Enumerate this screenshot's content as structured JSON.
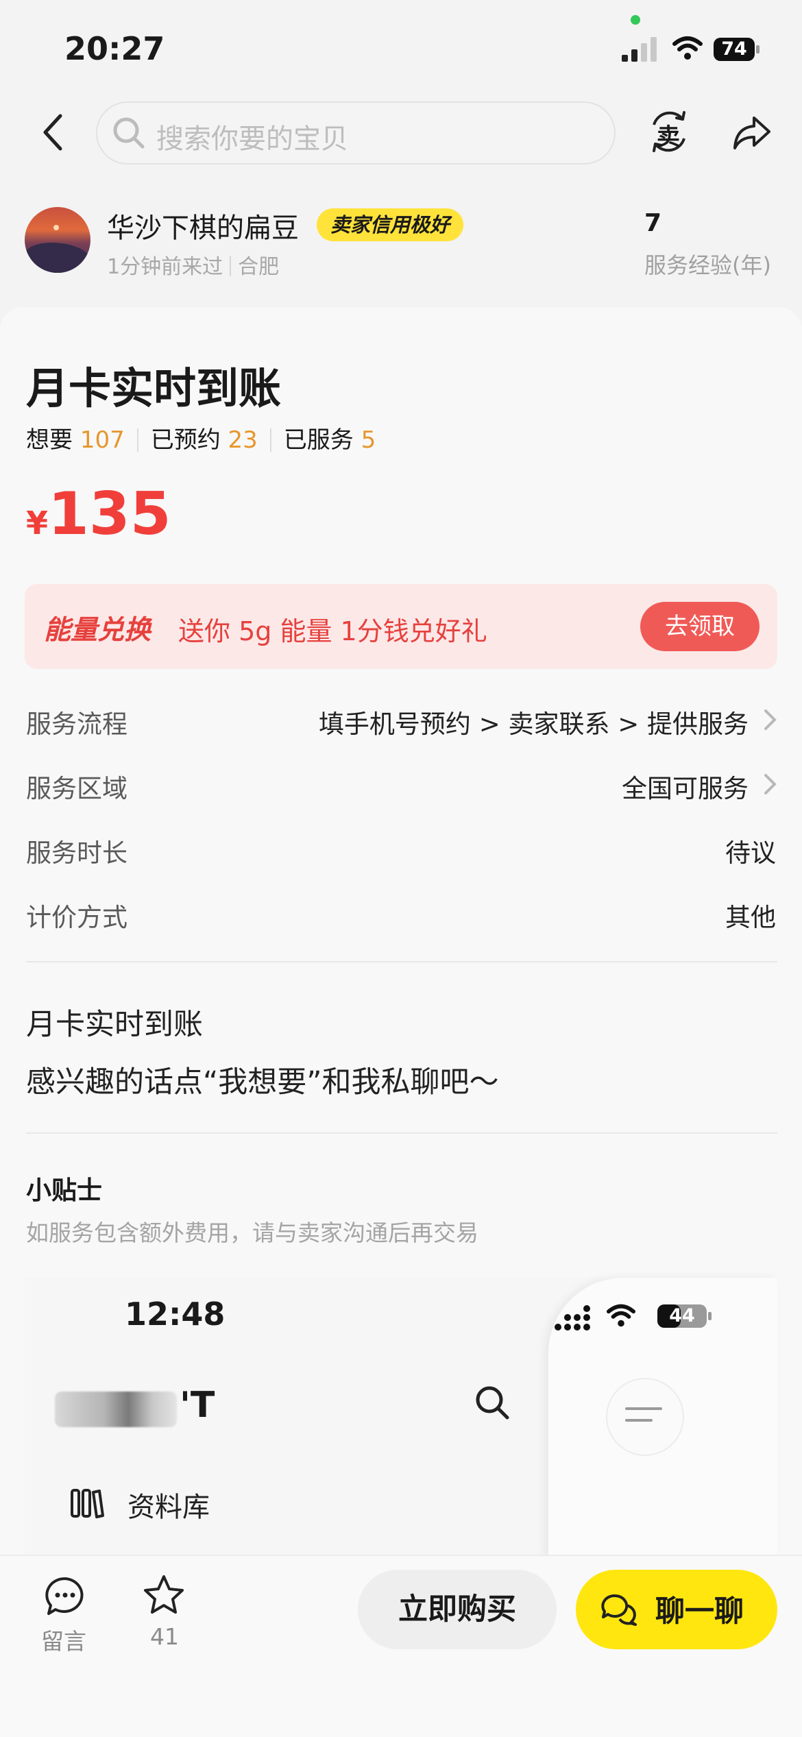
{
  "status_bar": {
    "time": "20:27",
    "battery": "74"
  },
  "nav": {
    "search_placeholder": "搜索你要的宝贝",
    "sell_icon_char": "卖"
  },
  "seller": {
    "name": "华沙下棋的扁豆",
    "badge": "卖家信用极好",
    "last_seen": "1分钟前来过",
    "location": "合肥",
    "years": "7",
    "years_label": "服务经验(年)"
  },
  "product": {
    "title": "月卡实时到账",
    "stats": [
      {
        "label": "想要",
        "value": "107"
      },
      {
        "label": "已预约",
        "value": "23"
      },
      {
        "label": "已服务",
        "value": "5"
      }
    ],
    "currency": "¥",
    "price": "135"
  },
  "promo": {
    "title": "能量兑换",
    "subtitle": "送你 5g 能量 1分钱兑好礼",
    "button": "去领取"
  },
  "details": [
    {
      "label": "服务流程",
      "value": "填手机号预约 > 卖家联系 > 提供服务",
      "has_arrow": true
    },
    {
      "label": "服务区域",
      "value": "全国可服务",
      "has_arrow": true
    },
    {
      "label": "服务时长",
      "value": "待议",
      "has_arrow": false
    },
    {
      "label": "计价方式",
      "value": "其他",
      "has_arrow": false
    }
  ],
  "description": {
    "line1": "月卡实时到账",
    "line2": "感兴趣的话点“我想要”和我私聊吧～"
  },
  "tips": {
    "title": "小贴士",
    "body": "如服务包含额外费用，请与卖家沟通后再交易"
  },
  "embedded": {
    "time": "12:48",
    "battery": "44",
    "title_fragment": "'T",
    "library": "资料库"
  },
  "bottom": {
    "message_label": "留言",
    "fav_count": "41",
    "buy_label": "立即购买",
    "chat_label": "聊一聊"
  },
  "colors": {
    "accent_yellow": "#ffe60f",
    "price_red": "#f03f3a",
    "stat_orange": "#e6962c"
  }
}
